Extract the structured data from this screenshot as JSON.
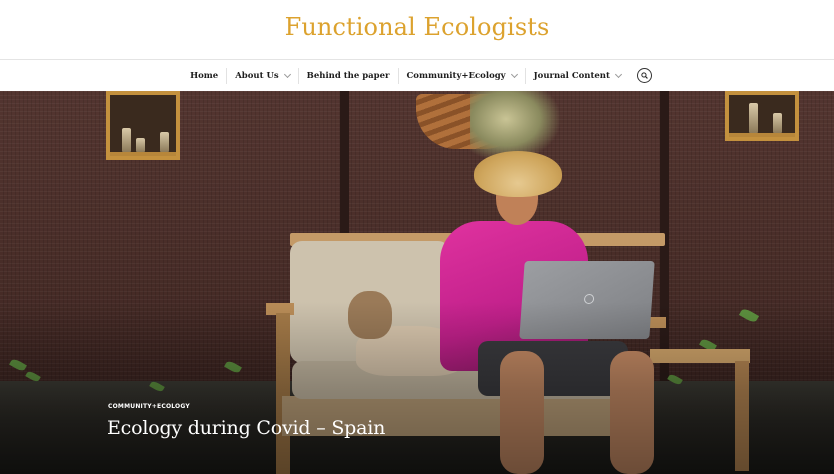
{
  "site": {
    "title": "Functional Ecologists",
    "title_color": "#dca22e"
  },
  "nav": {
    "items": [
      {
        "label": "Home",
        "has_dropdown": false
      },
      {
        "label": "About Us",
        "has_dropdown": true
      },
      {
        "label": "Behind the paper",
        "has_dropdown": false
      },
      {
        "label": "Community+Ecology",
        "has_dropdown": true
      },
      {
        "label": "Journal Content",
        "has_dropdown": true
      }
    ],
    "search_icon": "search-icon"
  },
  "hero": {
    "image_description_icon": "featured-photo",
    "category": "COMMUNITY+ECOLOGY",
    "title": "Ecology during Covid – Spain"
  }
}
